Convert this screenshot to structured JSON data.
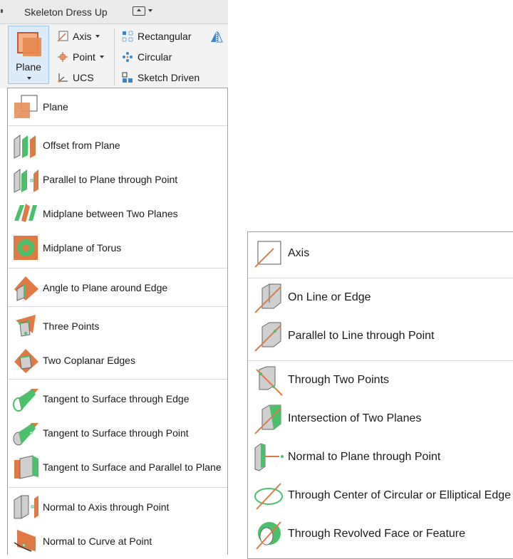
{
  "ribbon": {
    "tab_title": "Skeleton Dress Up",
    "plane_label": "Plane",
    "buttons": {
      "axis": "Axis",
      "point": "Point",
      "ucs": "UCS",
      "rectangular": "Rectangular",
      "circular": "Circular",
      "sketch_driven": "Sketch Driven"
    }
  },
  "plane_menu": {
    "items": [
      "Plane",
      "Offset from Plane",
      "Parallel to Plane through Point",
      "Midplane between Two Planes",
      "Midplane of Torus",
      "Angle to Plane around Edge",
      "Three Points",
      "Two Coplanar Edges",
      "Tangent to Surface through Edge",
      "Tangent to Surface through Point",
      "Tangent to Surface and Parallel to Plane",
      "Normal to Axis through Point",
      "Normal to Curve at Point"
    ]
  },
  "axis_menu": {
    "items": [
      "Axis",
      "On Line or Edge",
      "Parallel to Line  through Point",
      "Through Two Points",
      "Intersection of Two Planes",
      "Normal to Plane through Point",
      "Through Center of Circular or Elliptical Edge",
      "Through Revolved Face or Feature"
    ]
  },
  "colors": {
    "orange": "#e07a45",
    "green": "#4cbf6a",
    "gray": "#cfcfcf",
    "ribbon_bg": "#f3f3f3",
    "highlight": "#dcebfa"
  }
}
